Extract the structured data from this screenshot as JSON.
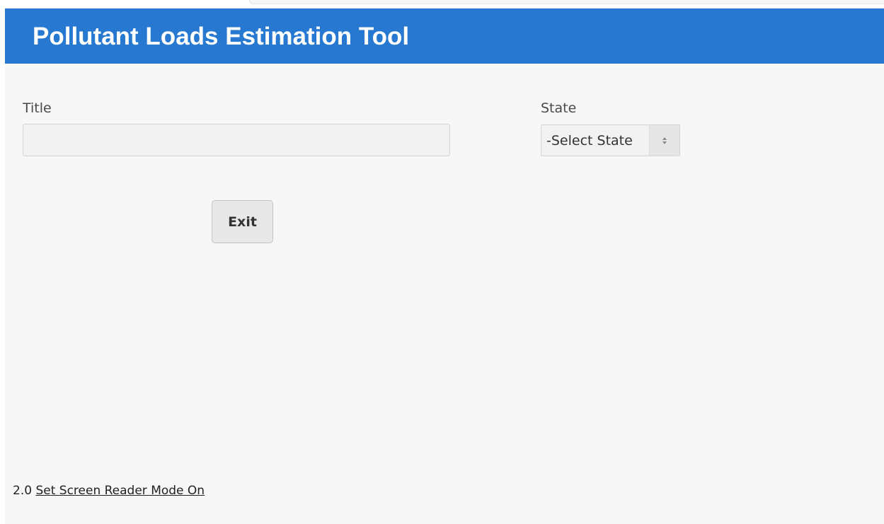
{
  "header": {
    "title": "Pollutant Loads Estimation Tool"
  },
  "form": {
    "title_label": "Title",
    "title_value": "",
    "state_label": "State",
    "state_selected": "-Select State"
  },
  "actions": {
    "exit_label": "Exit"
  },
  "footer": {
    "version": "2.0",
    "screen_reader_link": "Set Screen Reader Mode On"
  },
  "colors": {
    "header_background": "#2678d0",
    "page_background": "#f7f7f7"
  },
  "icons": {
    "state_select_arrow": "sort-arrows-icon"
  }
}
